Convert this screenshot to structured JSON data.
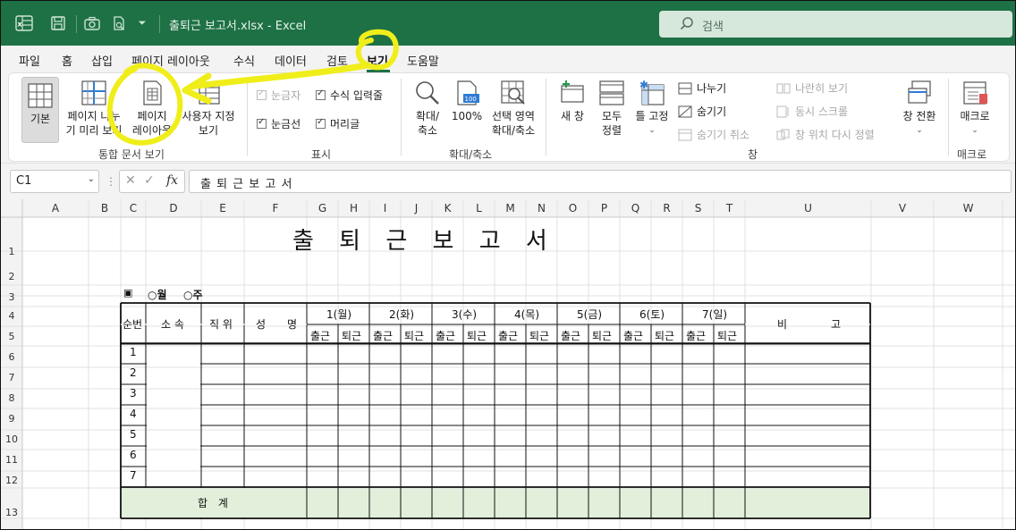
{
  "titlebar": {
    "doc_title": "출퇴근 보고서.xlsx  -  Excel",
    "search_placeholder": "검색"
  },
  "tabs": [
    "파일",
    "홈",
    "삽입",
    "페이지 레이아웃",
    "수식",
    "데이터",
    "검토",
    "보기",
    "도움말"
  ],
  "active_tab": "보기",
  "ribbon": {
    "workbook_views": {
      "normal": "기본",
      "page_break_1": "페이지 나누",
      "page_break_2": "기 미리 보기",
      "page_layout_1": "페이지",
      "page_layout_2": "레이아웃",
      "custom_1": "사용자 지정",
      "custom_2": "보기",
      "label": "통합 문서 보기"
    },
    "show": {
      "ruler": "눈금자",
      "formula_bar": "수식 입력줄",
      "gridlines": "눈금선",
      "headings": "머리글",
      "label": "표시"
    },
    "zoom": {
      "zoom_1": "확대/",
      "zoom_2": "축소",
      "hundred": "100%",
      "sel_1": "선택 영역",
      "sel_2": "확대/축소",
      "label": "확대/축소"
    },
    "window": {
      "new_window": "새 창",
      "arrange_1": "모두",
      "arrange_2": "정렬",
      "freeze": "틀 고정",
      "split": "나누기",
      "hide": "숨기기",
      "unhide": "숨기기 취소",
      "side_by_side": "나란히 보기",
      "sync_scroll": "동시 스크롤",
      "reset_pos": "창 위치 다시 정렬",
      "switch_1": "창 전환",
      "label": "창"
    },
    "macros": {
      "macro": "매크로",
      "label": "매크로"
    }
  },
  "formula_bar": {
    "name_box": "C1",
    "formula": "출 퇴 근   보 고 서"
  },
  "columns": [
    "A",
    "B",
    "C",
    "D",
    "E",
    "F",
    "G",
    "H",
    "I",
    "J",
    "K",
    "L",
    "M",
    "N",
    "O",
    "P",
    "Q",
    "R",
    "S",
    "T",
    "U",
    "V",
    "W"
  ],
  "rows": [
    "1",
    "2",
    "3",
    "4",
    "5",
    "6",
    "7",
    "8",
    "9",
    "10",
    "11",
    "12",
    "13"
  ],
  "sheet": {
    "title": "출 퇴 근   보 고 서",
    "period_marker": "▣",
    "period_month": "○월",
    "period_week": "○주",
    "hdr_no": "순번",
    "hdr_dept": "소 속",
    "hdr_position": "직 위",
    "hdr_name_1": "성",
    "hdr_name_2": "명",
    "days": [
      "1(월)",
      "2(화)",
      "3(수)",
      "4(목)",
      "5(금)",
      "6(토)",
      "7(일)"
    ],
    "in": "출근",
    "out": "퇴근",
    "hdr_remark_1": "비",
    "hdr_remark_2": "고",
    "row_numbers": [
      "1",
      "2",
      "3",
      "4",
      "5",
      "6",
      "7"
    ],
    "total": "합  계"
  },
  "colors": {
    "excel_green": "#1e7145",
    "total_row_fill": "#e2efda",
    "highlight_yellow": "#f0ee1a"
  }
}
